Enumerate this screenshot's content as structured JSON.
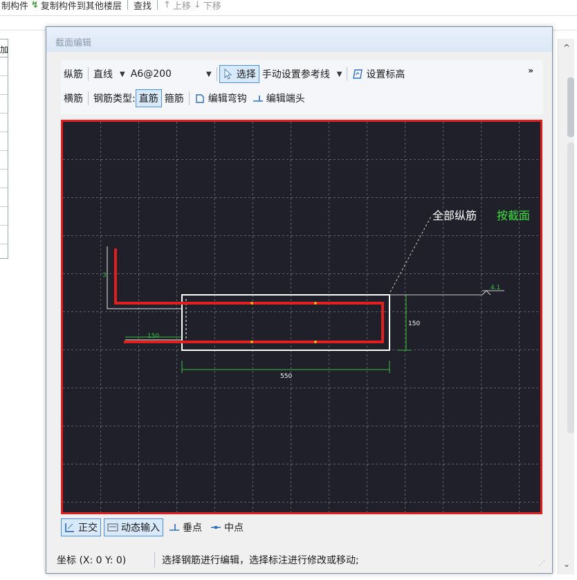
{
  "top_toolbar": {
    "items": [
      "制构件",
      "复制构件到其他楼层",
      "查找",
      "上移",
      "下移"
    ]
  },
  "left_table": {
    "header": "加"
  },
  "dialog": {
    "title": "截面编辑",
    "ribbon": {
      "row1": {
        "longitudinal": "纵筋",
        "line_mode": "直线",
        "spec_value": "A6@200",
        "select": "选择",
        "ref_line": "手动设置参考线",
        "set_elevation": "设置标高",
        "more": "»"
      },
      "row2": {
        "transverse": "横筋",
        "rebar_type_label": "钢筋类型:",
        "straight": "直筋",
        "stirrup": "箍筋",
        "edit_hook": "编辑弯钩",
        "edit_end": "编辑端头"
      }
    },
    "canvas": {
      "annotation_white": "全部纵筋",
      "annotation_green": "按截面",
      "dim_width": "550",
      "dim_height": "150",
      "dim_left": "150",
      "dim_side": "3",
      "elev_label": "4.1",
      "colors": {
        "bg": "#1f2029",
        "rebar": "#e02020",
        "dim": "#38c040",
        "outline": "#ffffff"
      }
    },
    "bottom_bar": {
      "ortho": "正交",
      "dynamic_input": "动态输入",
      "perpendicular": "垂点",
      "midpoint": "中点"
    },
    "status": {
      "coord": "坐标 (X: 0 Y: 0)",
      "message": "选择钢筋进行编辑，选择标注进行修改或移动;"
    }
  }
}
